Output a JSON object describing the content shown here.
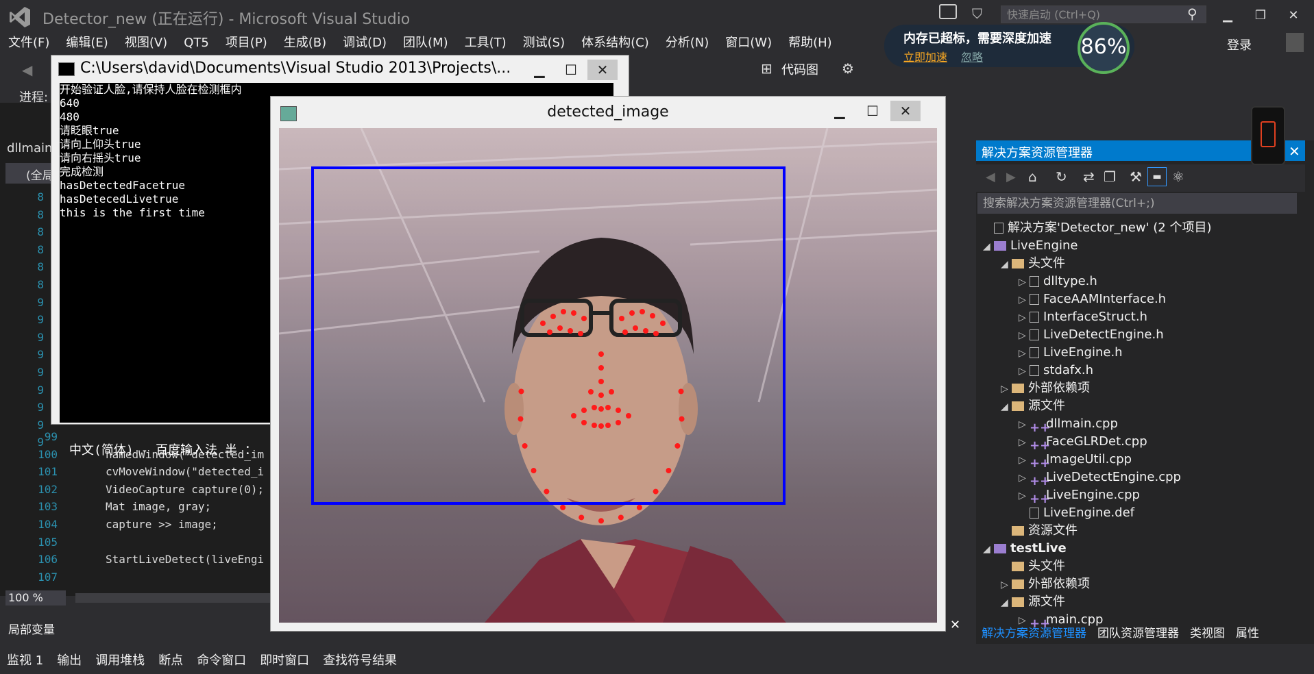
{
  "titlebar": {
    "title": "Detector_new (正在运行) - Microsoft Visual Studio",
    "quick_launch_placeholder": "快速启动 (Ctrl+Q)",
    "min": "▁",
    "max": "❐",
    "close": "✕"
  },
  "menu": [
    "文件(F)",
    "编辑(E)",
    "视图(V)",
    "QT5",
    "项目(P)",
    "生成(B)",
    "调试(D)",
    "团队(M)",
    "工具(T)",
    "测试(S)",
    "体系结构(C)",
    "分析(N)",
    "窗口(W)",
    "帮助(H)"
  ],
  "boost": {
    "title": "内存已超标，需要深度加速",
    "accelerate": "立即加速",
    "ignore": "忽略",
    "percent": "86%"
  },
  "login": "登录",
  "toolbar": {
    "progress_label": "进程:",
    "code_map": "代码图"
  },
  "editor": {
    "tab": "dllmain",
    "scope": "(全局",
    "line_numbers": [
      "99",
      "100",
      "101",
      "102",
      "103",
      "104",
      "105",
      "106",
      "107"
    ],
    "lines": [
      "",
      "namedWindow(\"detected_im",
      "cvMoveWindow(\"detected_i",
      "VideoCapture capture(0);",
      "Mat image, gray;",
      "capture >> image;",
      "",
      "StartLiveDetect(liveEngi",
      ""
    ],
    "gutter_digits": [
      "8",
      "8",
      "8",
      "8",
      "8",
      "8",
      "9",
      "9",
      "9",
      "9",
      "9",
      "9",
      "9",
      "9",
      "9"
    ],
    "zoom": "100 %"
  },
  "console": {
    "title": "C:\\Users\\david\\Documents\\Visual Studio 2013\\Projects\\...",
    "lines": [
      "开始验证人脸,请保持人脸在检测框内",
      "640",
      "480",
      "请眨眼true",
      "请向上仰头true",
      "请向右摇头true",
      "完成检测",
      "hasDetectedFacetrue",
      "hasDetecedLivetrue",
      "this is the first time"
    ],
    "ime": "中文(简体) - 百度输入法 半 ："
  },
  "detected_window": {
    "title": "detected_image",
    "box_color": "#0000ff",
    "landmark_color": "#ff1a1a"
  },
  "solution_explorer": {
    "title": "解决方案资源管理器",
    "search_placeholder": "搜索解决方案资源管理器(Ctrl+;)",
    "tree": [
      {
        "depth": 0,
        "tri": "",
        "icon": "solution",
        "label": "解决方案'Detector_new' (2 个项目)"
      },
      {
        "depth": 0,
        "tri": "◢",
        "icon": "project",
        "label": "LiveEngine"
      },
      {
        "depth": 1,
        "tri": "◢",
        "icon": "folder",
        "label": "头文件"
      },
      {
        "depth": 2,
        "tri": "▷",
        "icon": "header",
        "label": "dlltype.h"
      },
      {
        "depth": 2,
        "tri": "▷",
        "icon": "header",
        "label": "FaceAAMInterface.h"
      },
      {
        "depth": 2,
        "tri": "▷",
        "icon": "header",
        "label": "InterfaceStruct.h"
      },
      {
        "depth": 2,
        "tri": "▷",
        "icon": "header",
        "label": "LiveDetectEngine.h"
      },
      {
        "depth": 2,
        "tri": "▷",
        "icon": "header",
        "label": "LiveEngine.h"
      },
      {
        "depth": 2,
        "tri": "▷",
        "icon": "header",
        "label": "stdafx.h"
      },
      {
        "depth": 1,
        "tri": "▷",
        "icon": "folder",
        "label": "外部依赖项"
      },
      {
        "depth": 1,
        "tri": "◢",
        "icon": "folder",
        "label": "源文件"
      },
      {
        "depth": 2,
        "tri": "▷",
        "icon": "cpp",
        "label": "dllmain.cpp"
      },
      {
        "depth": 2,
        "tri": "▷",
        "icon": "cpp",
        "label": "FaceGLRDet.cpp"
      },
      {
        "depth": 2,
        "tri": "▷",
        "icon": "cpp",
        "label": "ImageUtil.cpp"
      },
      {
        "depth": 2,
        "tri": "▷",
        "icon": "cpp",
        "label": "LiveDetectEngine.cpp"
      },
      {
        "depth": 2,
        "tri": "▷",
        "icon": "cpp",
        "label": "LiveEngine.cpp"
      },
      {
        "depth": 2,
        "tri": "",
        "icon": "file",
        "label": "LiveEngine.def"
      },
      {
        "depth": 1,
        "tri": "",
        "icon": "folder",
        "label": "资源文件"
      },
      {
        "depth": 0,
        "tri": "◢",
        "icon": "project",
        "label": "testLive"
      },
      {
        "depth": 1,
        "tri": "",
        "icon": "folder",
        "label": "头文件"
      },
      {
        "depth": 1,
        "tri": "▷",
        "icon": "folder",
        "label": "外部依赖项"
      },
      {
        "depth": 1,
        "tri": "◢",
        "icon": "folder",
        "label": "源文件"
      },
      {
        "depth": 2,
        "tri": "▷",
        "icon": "cpp",
        "label": "main.cpp"
      }
    ],
    "tabs": [
      "解决方案资源管理器",
      "团队资源管理器",
      "类视图",
      "属性"
    ]
  },
  "locals": {
    "title": "局部变量"
  },
  "bottom_tabs": [
    "监视 1",
    "输出",
    "调用堆栈",
    "断点",
    "命令窗口",
    "即时窗口",
    "查找符号结果"
  ]
}
